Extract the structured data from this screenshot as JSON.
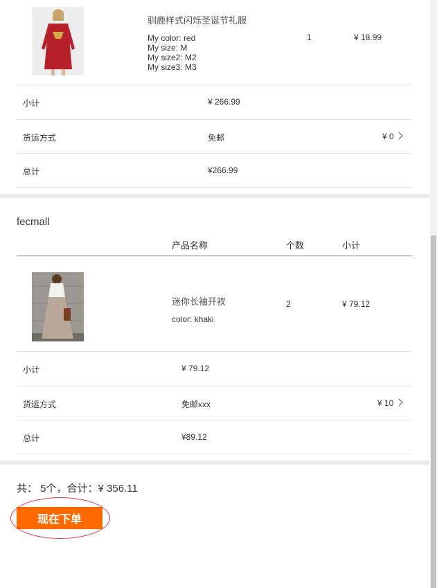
{
  "item1": {
    "name": "驯鹿样式闪烁圣诞节礼服",
    "options": [
      "My color: red",
      "My size: M",
      "My size2: M2",
      "My size3: M3"
    ],
    "qty": "1",
    "price": "¥ 18.99",
    "image": "red-dress-photo"
  },
  "store1_summary": {
    "subtotal_label": "小计",
    "subtotal_value": "¥ 266.99",
    "shipping_label": "货运方式",
    "shipping_value": "免邮",
    "shipping_cost": "¥ 0",
    "total_label": "总计",
    "total_value": "¥266.99"
  },
  "store2": {
    "name": "fecmall",
    "columns": [
      "产品名称",
      "个数",
      "小计"
    ],
    "item": {
      "name": "迷你长袖开衩",
      "option": "color: khaki",
      "qty": "2",
      "price": "¥ 79.12",
      "image": "maxi-dress-photo"
    },
    "subtotal_label": "小计",
    "subtotal_value": "¥ 79.12",
    "shipping_label": "货运方式",
    "shipping_value": "免邮xxx",
    "shipping_cost": "¥ 10",
    "total_label": "总计",
    "total_value": "¥89.12"
  },
  "footer": {
    "summary": "共： 5个，合计：¥ 356.11",
    "order_button": "现在下单"
  }
}
